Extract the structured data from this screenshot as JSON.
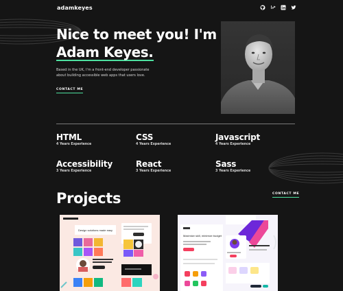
{
  "header": {
    "logo": "adamkeyes",
    "socials": [
      "github-icon",
      "frontend-mentor-icon",
      "linkedin-icon",
      "twitter-icon"
    ]
  },
  "hero": {
    "title_line1": "Nice to meet you! I'm",
    "name": "Adam Keyes.",
    "intro": "Based in the UK, I'm a front-end developer passionate about building accessible web apps that users love.",
    "contact_label": "CONTACT ME"
  },
  "skills": [
    {
      "name": "HTML",
      "experience": "4 Years Experience"
    },
    {
      "name": "CSS",
      "experience": "4 Years Experience"
    },
    {
      "name": "Javascript",
      "experience": "4 Years Experience"
    },
    {
      "name": "Accessibility",
      "experience": "3 Years Experience"
    },
    {
      "name": "React",
      "experience": "3 Years Experience"
    },
    {
      "name": "Sass",
      "experience": "3 Years Experience"
    }
  ],
  "projects": {
    "title": "Projects",
    "contact_label": "CONTACT ME",
    "thumb1_text": "Design solutions made easy",
    "thumb2_text": "Maximize skill, minimize budget"
  },
  "colors": {
    "background": "#151515",
    "accent": "#4ee1a0",
    "text": "#ffffff",
    "muted": "#d9d9d9"
  }
}
